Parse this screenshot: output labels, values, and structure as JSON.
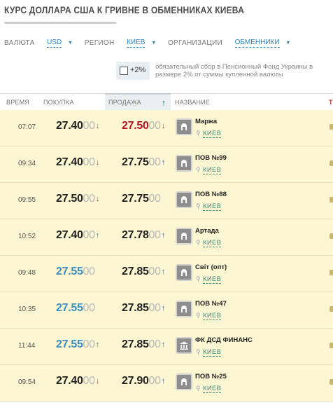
{
  "page": {
    "title": "КУРС ДОЛЛАРА США К ГРИВНЕ В ОБМЕННИКАХ КИЕВА"
  },
  "filters": {
    "currency_label": "ВАЛЮТА",
    "currency_value": "USD",
    "region_label": "РЕГИОН",
    "region_value": "КИЕВ",
    "org_label": "ОРГАНИЗАЦИИ",
    "org_value": "ОБМЕННИКИ"
  },
  "fee": {
    "toggle_label": "+2%",
    "checked": false,
    "note": "обязательный сбор в Пенсионный Фонд Украины в размере 2% от суммы купленной валюты"
  },
  "table": {
    "headers": {
      "time": "ВРЕМЯ",
      "buy": "ПОКУПКА",
      "sell": "ПРОДАЖА",
      "name": "НАЗВАНИЕ"
    },
    "sorted_by": "sell",
    "sort_direction": "up",
    "colors": {
      "row_bg": "#fdf6d3",
      "rate_dark": "#222222",
      "rate_red": "#b4142a",
      "rate_blue": "#3b8fbf",
      "arrow_up": "#2d6fb8",
      "arrow_down": "#c0392b",
      "city": "#3f8f7a"
    },
    "rows": [
      {
        "time": "07:07",
        "buy_main": "27.40",
        "buy_tail": "00",
        "buy_trend": "down",
        "buy_color": "dark",
        "sell_main": "27.50",
        "sell_tail": "00",
        "sell_trend": "down",
        "sell_color": "red",
        "name": "Маржа",
        "city": "КИЕВ",
        "icon": "exchange-booth-icon"
      },
      {
        "time": "09:34",
        "buy_main": "27.40",
        "buy_tail": "00",
        "buy_trend": "down",
        "buy_color": "dark",
        "sell_main": "27.75",
        "sell_tail": "00",
        "sell_trend": "up",
        "sell_color": "dark",
        "name": "ПОВ №99",
        "city": "КИЕВ",
        "icon": "exchange-booth-icon"
      },
      {
        "time": "09:55",
        "buy_main": "27.50",
        "buy_tail": "00",
        "buy_trend": "down",
        "buy_color": "dark",
        "sell_main": "27.75",
        "sell_tail": "00",
        "sell_trend": "none",
        "sell_color": "dark",
        "name": "ПОВ №88",
        "city": "КИЕВ",
        "icon": "exchange-booth-icon"
      },
      {
        "time": "10:52",
        "buy_main": "27.40",
        "buy_tail": "00",
        "buy_trend": "up",
        "buy_color": "dark",
        "sell_main": "27.78",
        "sell_tail": "00",
        "sell_trend": "up",
        "sell_color": "dark",
        "name": "Артада",
        "city": "КИЕВ",
        "icon": "exchange-booth-icon"
      },
      {
        "time": "09:48",
        "buy_main": "27.55",
        "buy_tail": "00",
        "buy_trend": "none",
        "buy_color": "blue",
        "sell_main": "27.85",
        "sell_tail": "00",
        "sell_trend": "up",
        "sell_color": "dark",
        "name": "Світ (опт)",
        "city": "КИЕВ",
        "icon": "exchange-booth-icon"
      },
      {
        "time": "10:35",
        "buy_main": "27.55",
        "buy_tail": "00",
        "buy_trend": "none",
        "buy_color": "blue",
        "sell_main": "27.85",
        "sell_tail": "00",
        "sell_trend": "up",
        "sell_color": "dark",
        "name": "ПОВ №47",
        "city": "КИЕВ",
        "icon": "exchange-booth-icon"
      },
      {
        "time": "11:44",
        "buy_main": "27.55",
        "buy_tail": "00",
        "buy_trend": "up",
        "buy_color": "blue",
        "sell_main": "27.85",
        "sell_tail": "00",
        "sell_trend": "up",
        "sell_color": "dark",
        "name": "ФК ДСД ФИНАНС",
        "city": "КИЕВ",
        "icon": "bank-icon"
      },
      {
        "time": "09:54",
        "buy_main": "27.40",
        "buy_tail": "00",
        "buy_trend": "down",
        "buy_color": "dark",
        "sell_main": "27.90",
        "sell_tail": "00",
        "sell_trend": "up",
        "sell_color": "dark",
        "name": "ПОВ №25",
        "city": "КИЕВ",
        "icon": "exchange-booth-icon"
      }
    ]
  }
}
